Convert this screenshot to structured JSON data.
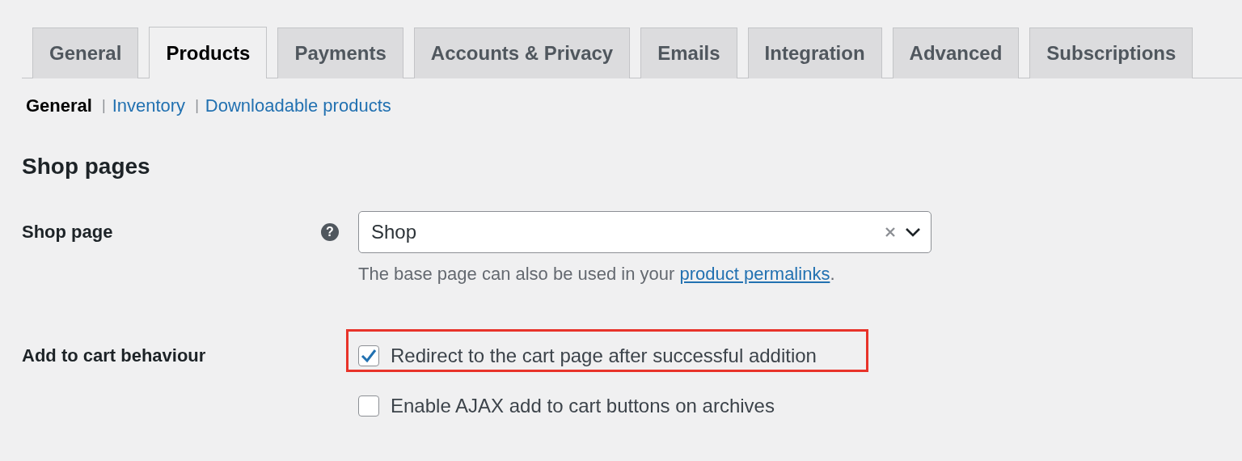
{
  "tabs": [
    {
      "label": "General",
      "selected": false
    },
    {
      "label": "Products",
      "selected": true
    },
    {
      "label": "Payments",
      "selected": false
    },
    {
      "label": "Accounts & Privacy",
      "selected": false
    },
    {
      "label": "Emails",
      "selected": false
    },
    {
      "label": "Integration",
      "selected": false
    },
    {
      "label": "Advanced",
      "selected": false
    },
    {
      "label": "Subscriptions",
      "selected": false
    }
  ],
  "subnav": [
    {
      "label": "General",
      "selected": true
    },
    {
      "separator": "|",
      "label": "Inventory",
      "selected": false
    },
    {
      "separator": "|",
      "label": "Downloadable products",
      "selected": false
    }
  ],
  "section_title": "Shop pages",
  "fields": [
    {
      "kind": "select",
      "label": "Shop page",
      "help": "?",
      "value": "Shop",
      "description": {
        "text": "The base page can also be used in your",
        "link": "product permalinks",
        "after": "."
      }
    },
    {
      "kind": "checkboxes",
      "label": "Add to cart behaviour",
      "options": [
        {
          "label": "Redirect to the cart page after successful addition",
          "checked": true,
          "highlighted": true
        },
        {
          "label": "Enable AJAX add to cart buttons on archives",
          "checked": false,
          "highlighted": false
        }
      ]
    }
  ]
}
